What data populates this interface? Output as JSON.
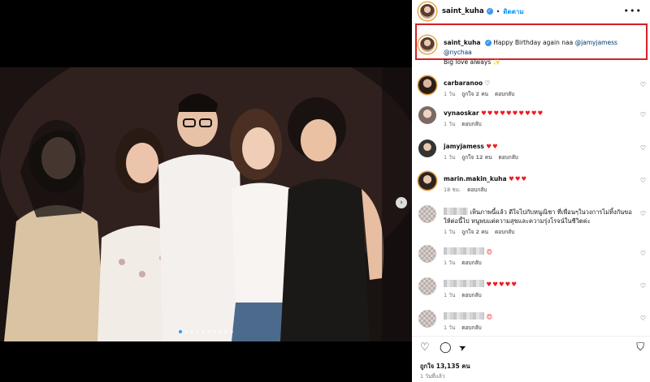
{
  "post": {
    "username": "saint_kuha",
    "separator": "•",
    "follow_label": "ติดตาม",
    "more_label": "•••",
    "caption": {
      "username": "saint_kuha",
      "text_before": "Happy Birthday again naa",
      "mention_1": "@jamyjamess",
      "mention_2": "@nychaa",
      "line2": "Big love always",
      "line2_emoji": "✨"
    }
  },
  "media": {
    "next_arrow": "›",
    "slides_total": 10,
    "slide_active": 1
  },
  "comments": [
    {
      "user": "carbaranoo",
      "text": "",
      "emoji": "♡",
      "time": "1 วัน",
      "likes": "ถูกใจ 2 คน",
      "reply": "ตอบกลับ"
    },
    {
      "user": "vynaoskar",
      "text": "",
      "emoji": "♥♥♥♥♥♥♥♥♥♥",
      "time": "1 วัน",
      "likes": "",
      "reply": "ตอบกลับ"
    },
    {
      "user": "jamyjamess",
      "text": "",
      "emoji": "♥♥",
      "time": "1 วัน",
      "likes": "ถูกใจ 12 คน",
      "reply": "ตอบกลับ"
    },
    {
      "user": "marin.makin_kuha",
      "text": "",
      "emoji": "♥♥♥",
      "time": "18 ชม.",
      "likes": "",
      "reply": "ตอบกลับ"
    },
    {
      "user": "",
      "text": "เห็นภาพนี้แล้ว ดีใจไปกับหนูณิชา ที่เพื่อนๆในวงการไม่ทิ้งกันขอให้ต่อนี้ไป หนูพบแต่ความสุขและความรุ่งโรจน์ในชีวิตค่ะ",
      "emoji": "",
      "time": "1 วัน",
      "likes": "ถูกใจ 2 คน",
      "reply": "ตอบกลับ"
    },
    {
      "user": "",
      "text": "",
      "emoji": "😍",
      "time": "1 วัน",
      "likes": "",
      "reply": "ตอบกลับ"
    },
    {
      "user": "",
      "text": "",
      "emoji": "♥♥♥♥♥",
      "time": "1 วัน",
      "likes": "",
      "reply": "ตอบกลับ"
    },
    {
      "user": "",
      "text": "",
      "emoji": "😍",
      "time": "1 วัน",
      "likes": "",
      "reply": "ตอบกลับ"
    }
  ],
  "actions": {
    "like_icon": "♡",
    "comment_icon": "◯",
    "share_icon": "➤",
    "save_icon": "⛉"
  },
  "likes_text": "ถูกใจ 13,135 คน",
  "time_ago": "1 วันที่แล้ว",
  "colors": {
    "accent": "#0095f6",
    "highlight_box": "#d62027",
    "heart": "#ed1c24"
  }
}
